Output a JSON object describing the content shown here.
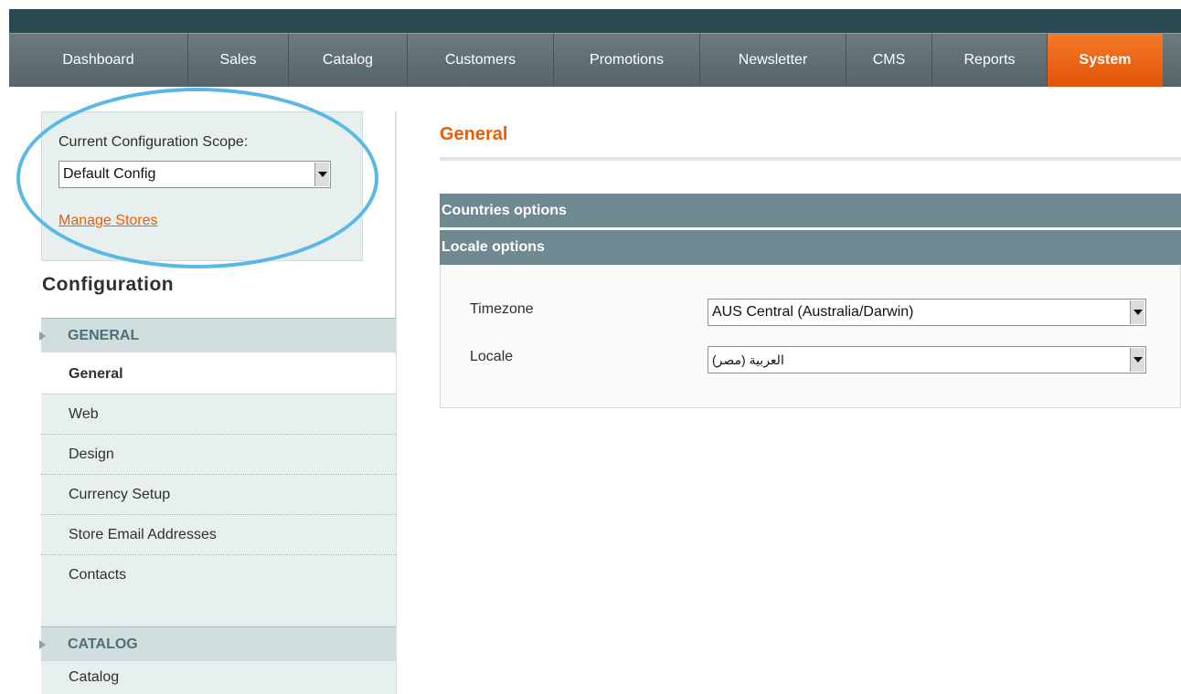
{
  "nav": {
    "items": [
      {
        "label": "Dashboard",
        "width": 196
      },
      {
        "label": "Sales",
        "width": 110
      },
      {
        "label": "Catalog",
        "width": 130
      },
      {
        "label": "Customers",
        "width": 160
      },
      {
        "label": "Promotions",
        "width": 160
      },
      {
        "label": "Newsletter",
        "width": 160
      },
      {
        "label": "CMS",
        "width": 94
      },
      {
        "label": "Reports",
        "width": 126
      },
      {
        "label": "System",
        "width": 126
      }
    ],
    "active": "System"
  },
  "scope": {
    "label": "Current Configuration Scope:",
    "selected": "Default Config",
    "manage_link": "Manage Stores"
  },
  "sidebar": {
    "title": "Configuration",
    "sections": [
      {
        "label": "GENERAL",
        "items": [
          "General",
          "Web",
          "Design",
          "Currency Setup",
          "Store Email Addresses",
          "Contacts"
        ],
        "current": "General"
      },
      {
        "label": "CATALOG",
        "items": [
          "Catalog"
        ]
      }
    ]
  },
  "main": {
    "title": "General",
    "fieldsets": [
      {
        "label": "Countries options"
      },
      {
        "label": "Locale options"
      }
    ],
    "fields": {
      "timezone_label": "Timezone",
      "timezone_value": "AUS Central (Australia/Darwin)",
      "locale_label": "Locale",
      "locale_value": "العربية (مصر)"
    }
  },
  "colors": {
    "accent": "#eb5e00",
    "nav_bg": "#5e6e72",
    "active_tab": "#e8600f",
    "fieldset_header": "#6f8992",
    "sidebar_bg": "#e7efef",
    "highlight_oval": "#5ab8e6"
  }
}
